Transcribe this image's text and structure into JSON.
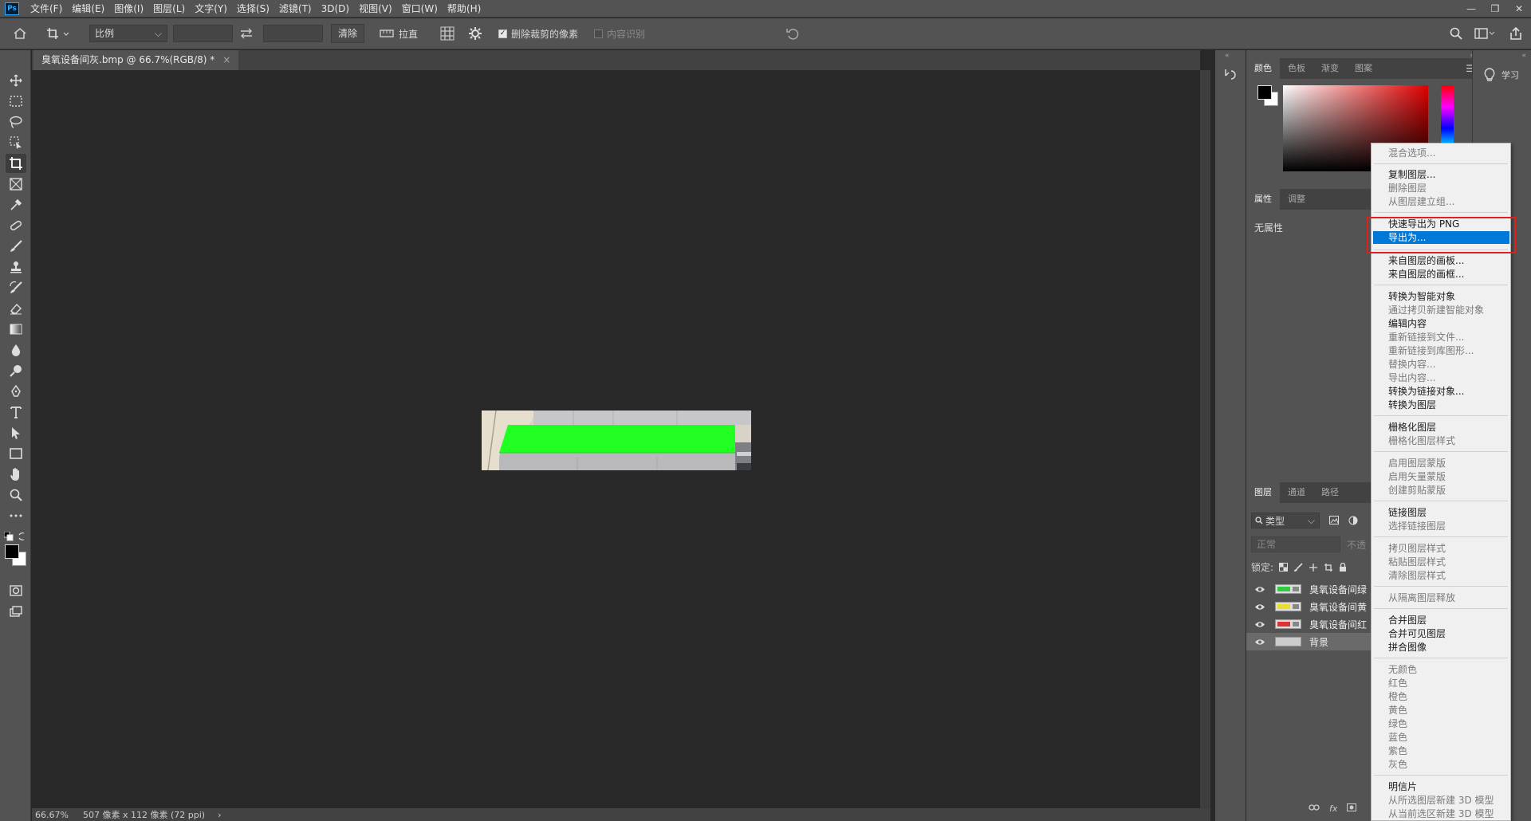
{
  "app": {
    "logo": "Ps"
  },
  "menu": [
    "文件(F)",
    "编辑(E)",
    "图像(I)",
    "图层(L)",
    "文字(Y)",
    "选择(S)",
    "滤镜(T)",
    "3D(D)",
    "视图(V)",
    "窗口(W)",
    "帮助(H)"
  ],
  "window_controls": {
    "minimize": "—",
    "restore": "❐",
    "close": "✕"
  },
  "options": {
    "ratio_select": "比例",
    "clear_button": "清除",
    "straighten_label": "拉直",
    "delete_cropped_label": "删除裁剪的像素",
    "delete_cropped_checked": true,
    "content_aware_label": "内容识别",
    "content_aware_checked": false
  },
  "document": {
    "tab_title": "臭氧设备间灰.bmp @ 66.7%(RGB/8) *",
    "close": "×",
    "zoom": "66.67%",
    "dimensions": "507 像素 x 112 像素 (72 ppi)",
    "status_arrow": "›"
  },
  "panels": {
    "color_tabs": [
      "颜色",
      "色板",
      "渐变",
      "图案"
    ],
    "properties_tabs": [
      "属性",
      "调整"
    ],
    "properties_empty": "无属性",
    "layers_tabs": [
      "图层",
      "通道",
      "路径"
    ],
    "layer_filter": "类型",
    "blend_mode": "正常",
    "opacity_label": "不透",
    "lock_label": "锁定:",
    "learn_label": "学习"
  },
  "layers": [
    {
      "name": "臭氧设备间绿",
      "color": "#2ecc40"
    },
    {
      "name": "臭氧设备间黄",
      "color": "#e8e030"
    },
    {
      "name": "臭氧设备间红",
      "color": "#e03030"
    },
    {
      "name": "背景",
      "color": "#cccccc"
    }
  ],
  "context_menu": {
    "highlighted": "导出为...",
    "items": [
      {
        "label": "混合选项...",
        "enabled": false
      },
      {
        "label": "复制图层...",
        "enabled": true
      },
      {
        "label": "删除图层",
        "enabled": false
      },
      {
        "label": "从图层建立组...",
        "enabled": false
      },
      {
        "label": "快速导出为 PNG",
        "enabled": true
      },
      {
        "label": "导出为...",
        "enabled": true
      },
      {
        "label": "来自图层的画板...",
        "enabled": true
      },
      {
        "label": "来自图层的画框...",
        "enabled": true
      },
      {
        "label": "转换为智能对象",
        "enabled": true
      },
      {
        "label": "通过拷贝新建智能对象",
        "enabled": false
      },
      {
        "label": "编辑内容",
        "enabled": true
      },
      {
        "label": "重新链接到文件...",
        "enabled": false
      },
      {
        "label": "重新链接到库图形...",
        "enabled": false
      },
      {
        "label": "替换内容...",
        "enabled": false
      },
      {
        "label": "导出内容...",
        "enabled": false
      },
      {
        "label": "转换为链接对象...",
        "enabled": true
      },
      {
        "label": "转换为图层",
        "enabled": true
      },
      {
        "label": "栅格化图层",
        "enabled": true
      },
      {
        "label": "栅格化图层样式",
        "enabled": false
      },
      {
        "label": "启用图层蒙版",
        "enabled": false
      },
      {
        "label": "启用矢量蒙版",
        "enabled": false
      },
      {
        "label": "创建剪贴蒙版",
        "enabled": false
      },
      {
        "label": "链接图层",
        "enabled": true
      },
      {
        "label": "选择链接图层",
        "enabled": false
      },
      {
        "label": "拷贝图层样式",
        "enabled": false
      },
      {
        "label": "粘贴图层样式",
        "enabled": false
      },
      {
        "label": "清除图层样式",
        "enabled": false
      },
      {
        "label": "从隔离图层释放",
        "enabled": false
      },
      {
        "label": "合并图层",
        "enabled": true
      },
      {
        "label": "合并可见图层",
        "enabled": true
      },
      {
        "label": "拼合图像",
        "enabled": true
      },
      {
        "label": "无颜色",
        "enabled": false
      },
      {
        "label": "红色",
        "enabled": false
      },
      {
        "label": "橙色",
        "enabled": false
      },
      {
        "label": "黄色",
        "enabled": false
      },
      {
        "label": "绿色",
        "enabled": false
      },
      {
        "label": "蓝色",
        "enabled": false
      },
      {
        "label": "紫色",
        "enabled": false
      },
      {
        "label": "灰色",
        "enabled": false
      },
      {
        "label": "明信片",
        "enabled": true
      },
      {
        "label": "从所选图层新建 3D 模型",
        "enabled": false
      },
      {
        "label": "从当前选区新建 3D 模型",
        "enabled": false
      }
    ]
  },
  "colors": {
    "highlight": "#0078d7",
    "annotation": "#e02020",
    "canvas_green": "#22ff22"
  }
}
